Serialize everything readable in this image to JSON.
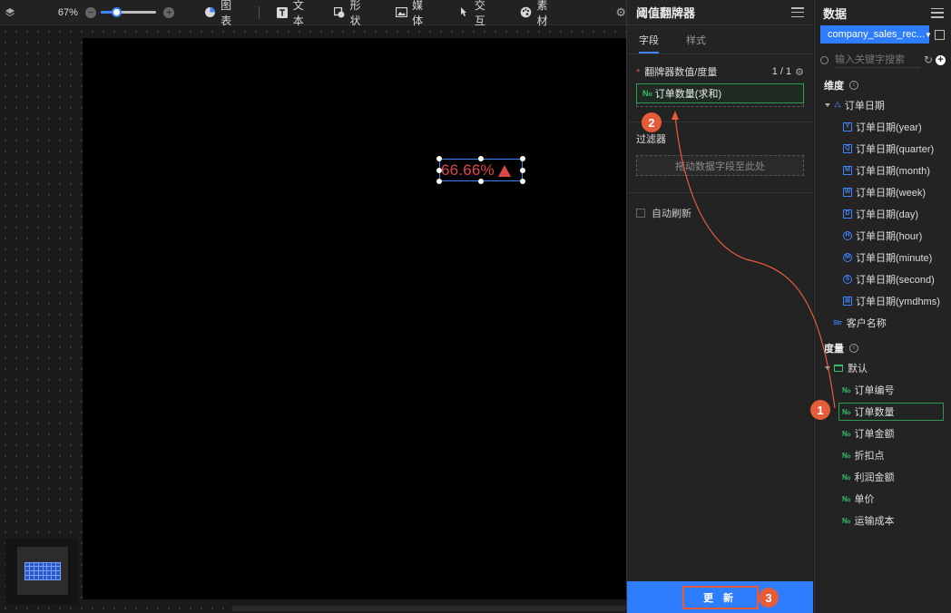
{
  "toolbar": {
    "zoom": "67%",
    "zoom_level_percent": 67,
    "items": [
      {
        "label": "图表",
        "icon": "pie-chart-icon"
      },
      {
        "label": "文本",
        "icon": "text-t-icon"
      },
      {
        "label": "形状",
        "icon": "shape-icon"
      },
      {
        "label": "媒体",
        "icon": "image-icon"
      },
      {
        "label": "交互",
        "icon": "interaction-icon"
      },
      {
        "label": "素材",
        "icon": "palette-icon"
      }
    ]
  },
  "canvas": {
    "widget_value": "66.66%",
    "trend": "up",
    "value_color": "#e04848"
  },
  "config_panel": {
    "title": "阈值翻牌器",
    "tabs": [
      "字段",
      "样式"
    ],
    "active_tab": "字段",
    "value_section": {
      "label": "翻牌器数值/度量",
      "count": "1 / 1",
      "field_tag": "N",
      "field": "订单数量(求和)"
    },
    "filter_section": {
      "label": "过滤器",
      "placeholder": "拖动数据字段至此处"
    },
    "auto_refresh": {
      "label": "自动刷新",
      "checked": false
    },
    "update_button": "更 新"
  },
  "data_panel": {
    "title": "数据",
    "dataset": "company_sales_rec...",
    "search_placeholder": "输入关键字搜索",
    "dimensions_title": "维度",
    "date_field": "订单日期",
    "date_children": [
      {
        "label": "订单日期(year)",
        "icon_letter": "Y"
      },
      {
        "label": "订单日期(quarter)",
        "icon_letter": "Q"
      },
      {
        "label": "订单日期(month)",
        "icon_letter": "M"
      },
      {
        "label": "订单日期(week)",
        "icon_letter": "W"
      },
      {
        "label": "订单日期(day)",
        "icon_letter": "D"
      },
      {
        "label": "订单日期(hour)",
        "icon_letter": "H"
      },
      {
        "label": "订单日期(minute)",
        "icon_letter": "M"
      },
      {
        "label": "订单日期(second)",
        "icon_letter": "S"
      },
      {
        "label": "订单日期(ymdhms)",
        "icon_letter": "▦"
      }
    ],
    "customer_field": "客户名称",
    "measures_title": "度量",
    "default_folder": "默认",
    "measure_tag": "N",
    "measures": [
      "订单编号",
      "订单数量",
      "订单金额",
      "折扣点",
      "利润金额",
      "单价",
      "运输成本"
    ],
    "selected_measure": "订单数量"
  },
  "annotations": [
    {
      "number": "1",
      "color": "#e65c3b"
    },
    {
      "number": "2",
      "color": "#e65c3b"
    },
    {
      "number": "3",
      "color": "#e65c3b"
    }
  ],
  "colors": {
    "accent": "#2f7dff",
    "annotation": "#e65c3b",
    "measure": "#35c06a",
    "dimension": "#3d82ff"
  }
}
